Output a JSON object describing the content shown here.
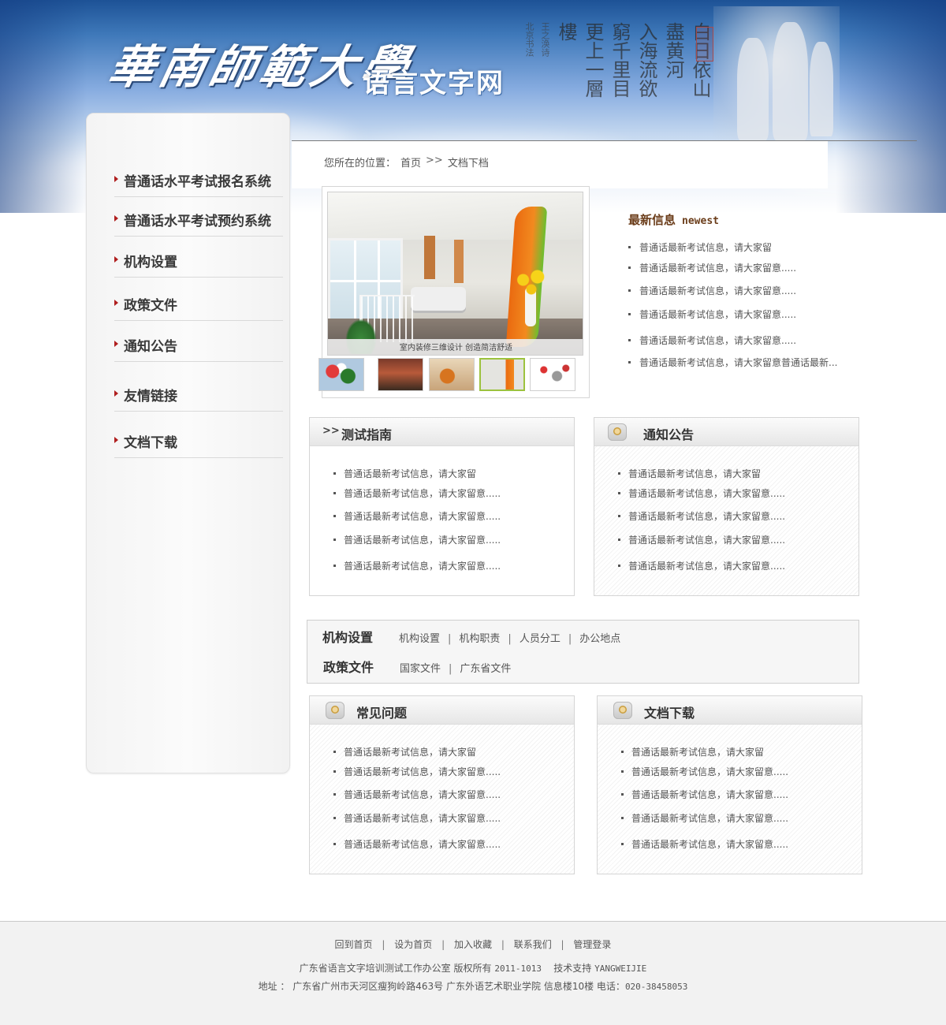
{
  "header": {
    "logo_script": "華南師範大學",
    "logo_sub": "语言文字网",
    "calligraphy_columns": [
      "白日依山",
      "盡黄河",
      "入海流欲",
      "窮千里目",
      "更上一層",
      "樓"
    ],
    "calligraphy_small": [
      "王之涣诗",
      "北京书法"
    ]
  },
  "sidebar": {
    "items": [
      {
        "label": "普通话水平考试报名系统"
      },
      {
        "label": "普通话水平考试预约系统"
      },
      {
        "label": "机构设置"
      },
      {
        "label": "政策文件"
      },
      {
        "label": "通知公告"
      },
      {
        "label": "友情链接"
      },
      {
        "label": "文档下载"
      }
    ]
  },
  "breadcrumb": {
    "prefix": "您所在的位置：",
    "home": "首页",
    "sep": ">>",
    "current": "文档下档"
  },
  "slideshow": {
    "caption": "室内装修三维设计 创造简洁舒适",
    "thumbnails": [
      "cartoon-thumb",
      "room-thumb",
      "sports-thumb",
      "interior-thumb",
      "figures-thumb"
    ],
    "active_index": 3
  },
  "newest": {
    "title_cn": "最新信息",
    "title_en": "newest",
    "items": [
      "普通话最新考试信息，请大家留",
      "普通话最新考试信息，请大家留意.....",
      "普通话最新考试信息，请大家留意.....",
      "普通话最新考试信息，请大家留意.....",
      "普通话最新考试信息，请大家留意.....",
      "普通话最新考试信息，请大家留意普通话最新..."
    ]
  },
  "boxes": {
    "test_guide": {
      "title": "测试指南",
      "chev": ">>",
      "items": [
        "普通话最新考试信息，请大家留",
        "普通话最新考试信息，请大家留意.....",
        "普通话最新考试信息，请大家留意.....",
        "普通话最新考试信息，请大家留意.....",
        "普通话最新考试信息，请大家留意....."
      ]
    },
    "notices": {
      "title": "通知公告",
      "items": [
        "普通话最新考试信息，请大家留",
        "普通话最新考试信息，请大家留意.....",
        "普通话最新考试信息，请大家留意.....",
        "普通话最新考试信息，请大家留意.....",
        "普通话最新考试信息，请大家留意....."
      ]
    },
    "faq": {
      "title": "常见问题",
      "items": [
        "普通话最新考试信息，请大家留",
        "普通话最新考试信息，请大家留意.....",
        "普通话最新考试信息，请大家留意.....",
        "普通话最新考试信息，请大家留意.....",
        "普通话最新考试信息，请大家留意....."
      ]
    },
    "downloads": {
      "title": "文档下载",
      "items": [
        "普通话最新考试信息，请大家留",
        "普通话最新考试信息，请大家留意.....",
        "普通话最新考试信息，请大家留意.....",
        "普通话最新考试信息，请大家留意.....",
        "普通话最新考试信息，请大家留意....."
      ]
    }
  },
  "links_panel": {
    "row1": {
      "label": "机构设置",
      "links": [
        "机构设置",
        "机构职责",
        "人员分工",
        "办公地点"
      ]
    },
    "row2": {
      "label": "政策文件",
      "links": [
        "国家文件",
        "广东省文件"
      ]
    },
    "sep": "|"
  },
  "footer": {
    "nav": [
      "回到首页",
      "设为首页",
      "加入收藏",
      "联系我们",
      "管理登录"
    ],
    "sep": "|",
    "copyright_org": "广东省语言文字培训测试工作办公室",
    "copyright_text": "版权所有",
    "copyright_years": "2011-1013",
    "support_label": "技术支持",
    "support_name": "YANGWEIJIE",
    "address_label": "地址 ：",
    "address": "广东省广州市天河区瘦狗岭路463号",
    "address_org": "广东外语艺术职业学院",
    "address_building": "信息楼10楼",
    "phone_label": "电话：",
    "phone": "020-38458053"
  },
  "colors": {
    "accent_arrow": "#b01f1f",
    "newest_title": "#6b3d1a",
    "active_thumb_border": "#9cc23e"
  }
}
